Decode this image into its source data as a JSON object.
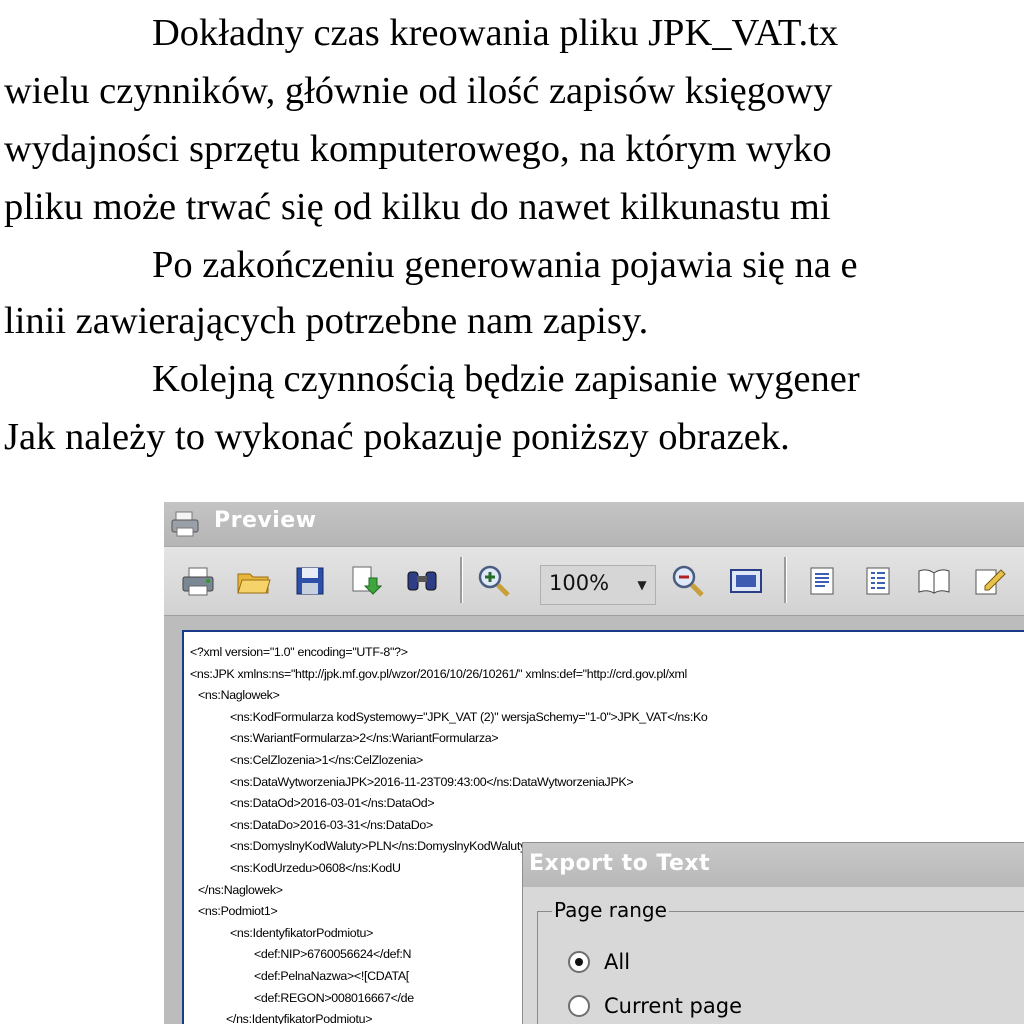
{
  "document": {
    "lines": [
      "Dokładny czas kreowania  pliku JPK_VAT.tx",
      "wielu czynników, głównie od ilość zapisów księgowy",
      "wydajności sprzętu komputerowego, na którym wyko",
      "pliku może trwać się od kilku do nawet kilkunastu mi",
      "Po zakończeniu generowania pojawia się na e",
      "linii  zawierających potrzebne nam zapisy.",
      "Kolejną czynnością będzie zapisanie wygener",
      "Jak należy to wykonać pokazuje poniższy obrazek."
    ]
  },
  "preview": {
    "title": "Preview",
    "zoom_value": "100%",
    "toolbar_icons": [
      "printer-icon",
      "open-folder-icon",
      "save-disk-icon",
      "export-icon",
      "find-binoculars-icon",
      "zoom-in-icon",
      "zoom-out-icon",
      "page-view-icon",
      "single-page-icon",
      "multi-page-icon",
      "book-icon",
      "edit-icon"
    ],
    "xml_lines": [
      "<?xml version=\"1.0\" encoding=\"UTF-8\"?>",
      "<ns:JPK xmlns:ns=\"http://jpk.mf.gov.pl/wzor/2016/10/26/10261/\" xmlns:def=\"http://crd.gov.pl/xml",
      "  <ns:Naglowek>",
      "        <ns:KodFormularza kodSystemowy=\"JPK_VAT (2)\" wersjaSchemy=\"1-0\">JPK_VAT</ns:Ko",
      "        <ns:WariantFormularza>2</ns:WariantFormularza>",
      "        <ns:CelZlozenia>1</ns:CelZlozenia>",
      "        <ns:DataWytworzeniaJPK>2016-11-23T09:43:00</ns:DataWytworzeniaJPK>",
      "        <ns:DataOd>2016-03-01</ns:DataOd>",
      "        <ns:DataDo>2016-03-31</ns:DataDo>",
      "        <ns:DomyslnyKodWaluty>PLN</ns:DomyslnyKodWaluty>",
      "        <ns:KodUrzedu>0608</ns:KodU",
      "  </ns:Naglowek>",
      "  <ns:Podmiot1>",
      "        <ns:IdentyfikatorPodmiotu>",
      "            <def:NIP>6760056624</def:N",
      "            <def:PelnaNazwa><![CDATA[",
      "            <def:REGON>008016667</de",
      "        </ns:IdentyfikatorPodmiotu>"
    ],
    "dialog": {
      "title": "Export to Text",
      "group_label": "Page range",
      "options": [
        {
          "label": "All",
          "checked": true
        },
        {
          "label": "Current page",
          "checked": false
        }
      ]
    }
  }
}
